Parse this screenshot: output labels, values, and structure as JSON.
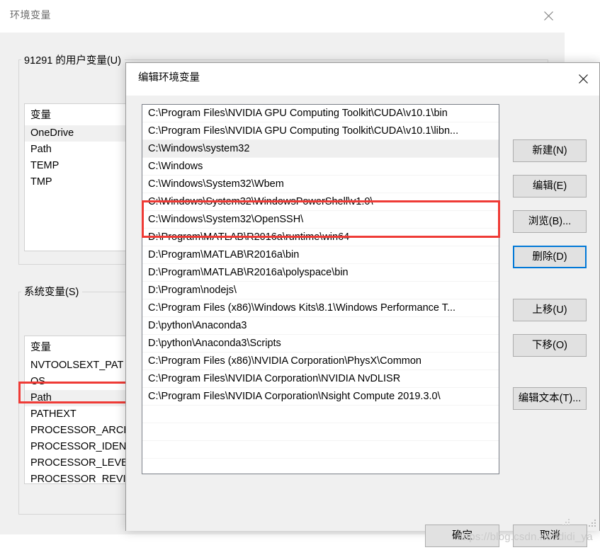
{
  "background_window": {
    "title": "环境变量",
    "close_icon": "close-icon",
    "user_section": {
      "legend": "91291 的用户变量(U)",
      "column_header": "变量",
      "rows": [
        {
          "name": "OneDrive",
          "highlighted": true
        },
        {
          "name": "Path",
          "highlighted": false
        },
        {
          "name": "TEMP",
          "highlighted": false
        },
        {
          "name": "TMP",
          "highlighted": false
        }
      ]
    },
    "system_section": {
      "legend": "系统变量(S)",
      "column_header": "变量",
      "rows": [
        {
          "name": "NVTOOLSEXT_PAT",
          "highlighted": false
        },
        {
          "name": "OS",
          "highlighted": false
        },
        {
          "name": "Path",
          "highlighted": true,
          "annotated": true
        },
        {
          "name": "PATHEXT",
          "highlighted": false
        },
        {
          "name": "PROCESSOR_ARCH",
          "highlighted": false
        },
        {
          "name": "PROCESSOR_IDENT",
          "highlighted": false
        },
        {
          "name": "PROCESSOR_LEVEL",
          "highlighted": false
        },
        {
          "name": "PROCESSOR_REVIS",
          "highlighted": false
        }
      ]
    }
  },
  "dialog": {
    "title": "编辑环境变量",
    "close_icon": "close-icon",
    "path_entries": [
      {
        "value": "C:\\Program Files\\NVIDIA GPU Computing Toolkit\\CUDA\\v10.1\\bin",
        "highlighted": false,
        "annotated": true
      },
      {
        "value": "C:\\Program Files\\NVIDIA GPU Computing Toolkit\\CUDA\\v10.1\\libn...",
        "highlighted": false,
        "annotated": true
      },
      {
        "value": "C:\\Windows\\system32",
        "highlighted": true,
        "annotated": false
      },
      {
        "value": "C:\\Windows",
        "highlighted": false,
        "annotated": false
      },
      {
        "value": "C:\\Windows\\System32\\Wbem",
        "highlighted": false,
        "annotated": false
      },
      {
        "value": "C:\\Windows\\System32\\WindowsPowerShell\\v1.0\\",
        "highlighted": false,
        "annotated": false
      },
      {
        "value": "C:\\Windows\\System32\\OpenSSH\\",
        "highlighted": false,
        "annotated": false
      },
      {
        "value": "D:\\Program\\MATLAB\\R2016a\\runtime\\win64",
        "highlighted": false,
        "annotated": false
      },
      {
        "value": "D:\\Program\\MATLAB\\R2016a\\bin",
        "highlighted": false,
        "annotated": false
      },
      {
        "value": "D:\\Program\\MATLAB\\R2016a\\polyspace\\bin",
        "highlighted": false,
        "annotated": false
      },
      {
        "value": "D:\\Program\\nodejs\\",
        "highlighted": false,
        "annotated": false
      },
      {
        "value": "C:\\Program Files (x86)\\Windows Kits\\8.1\\Windows Performance T...",
        "highlighted": false,
        "annotated": false
      },
      {
        "value": "D:\\python\\Anaconda3",
        "highlighted": false,
        "annotated": false
      },
      {
        "value": "D:\\python\\Anaconda3\\Scripts",
        "highlighted": false,
        "annotated": false
      },
      {
        "value": "C:\\Program Files (x86)\\NVIDIA Corporation\\PhysX\\Common",
        "highlighted": false,
        "annotated": false
      },
      {
        "value": "C:\\Program Files\\NVIDIA Corporation\\NVIDIA NvDLISR",
        "highlighted": false,
        "annotated": false
      },
      {
        "value": "C:\\Program Files\\NVIDIA Corporation\\Nsight Compute 2019.3.0\\",
        "highlighted": false,
        "annotated": false
      },
      {
        "value": "",
        "highlighted": false,
        "annotated": false
      },
      {
        "value": "",
        "highlighted": false,
        "annotated": false
      },
      {
        "value": "",
        "highlighted": false,
        "annotated": false
      }
    ],
    "buttons": {
      "new": "新建(N)",
      "edit": "编辑(E)",
      "browse": "浏览(B)...",
      "delete": "删除(D)",
      "move_up": "上移(U)",
      "move_down": "下移(O)",
      "edit_text": "编辑文本(T)...",
      "ok": "确定",
      "cancel": "取消"
    },
    "focused_button": "删除(D)"
  },
  "watermark": {
    "text": "https://blog.csdn.net/didi_ya"
  },
  "colors": {
    "accent_focus": "#0078d7",
    "annotation_red": "#ef3b36",
    "dialog_face": "#f0f0f0",
    "button_face": "#e1e1e1",
    "row_highlight": "#efefef",
    "watermark": "#c9c9c9"
  }
}
